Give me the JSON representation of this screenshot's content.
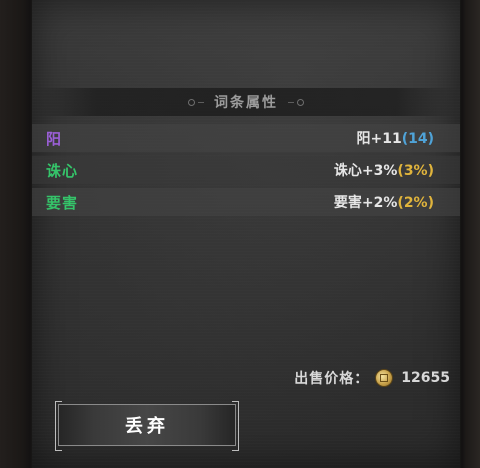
{
  "section": {
    "title": "词条属性"
  },
  "attributes": [
    {
      "name": "阳",
      "name_color": "#9a5fd6",
      "value": "阳+11",
      "bonus": "(14)",
      "bonus_color": "blue"
    },
    {
      "name": "诛心",
      "name_color": "#35c46a",
      "value": "诛心+3%",
      "bonus": "(3%)",
      "bonus_color": "gold"
    },
    {
      "name": "要害",
      "name_color": "#35c46a",
      "value": "要害+2%",
      "bonus": "(2%)",
      "bonus_color": "gold"
    }
  ],
  "price": {
    "label": "出售价格：",
    "icon": "coin-icon",
    "amount": "12655"
  },
  "actions": {
    "discard_label": "丢弃"
  }
}
